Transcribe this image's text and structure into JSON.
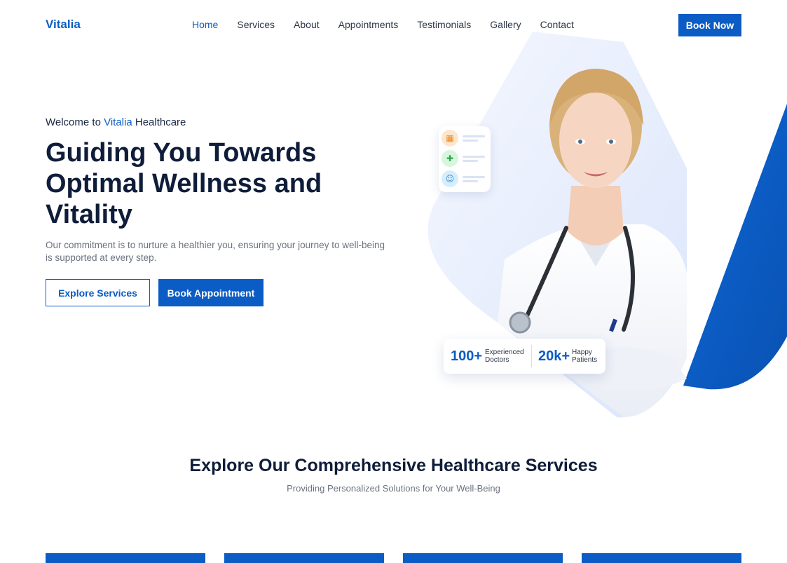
{
  "nav": {
    "brand": "Vitalia",
    "items": [
      {
        "label": "Home",
        "active": true
      },
      {
        "label": "Services"
      },
      {
        "label": "About"
      },
      {
        "label": "Appointments"
      },
      {
        "label": "Testimonials"
      },
      {
        "label": "Gallery"
      },
      {
        "label": "Contact"
      }
    ],
    "cta": "Book Now"
  },
  "hero": {
    "welcome_prefix": "Welcome to",
    "welcome_highlight": "Vitalia",
    "welcome_suffix": "Healthcare",
    "title": "Guiding You Towards Optimal Wellness and Vitality",
    "subtitle": "Our commitment is to nurture a healthier you, ensuring your journey to well-being is supported at every step.",
    "btn_explore": "Explore Services",
    "btn_appointment": "Book Appointment",
    "mini_card_icons": [
      "calendar-icon",
      "medical-kit-icon",
      "smile-icon"
    ],
    "stats": [
      {
        "value": "100+",
        "label_line1": "Experienced",
        "label_line2": "Doctors"
      },
      {
        "value": "20k+",
        "label_line1": "Happy",
        "label_line2": "Patients"
      }
    ]
  },
  "services": {
    "title": "Explore Our Comprehensive Healthcare Services",
    "subtitle": "Providing Personalized Solutions for Your Well-Being",
    "card_count": 4
  },
  "colors": {
    "primary": "#0b5cc4",
    "heading": "#0f1d3a",
    "muted": "#6b7280"
  }
}
